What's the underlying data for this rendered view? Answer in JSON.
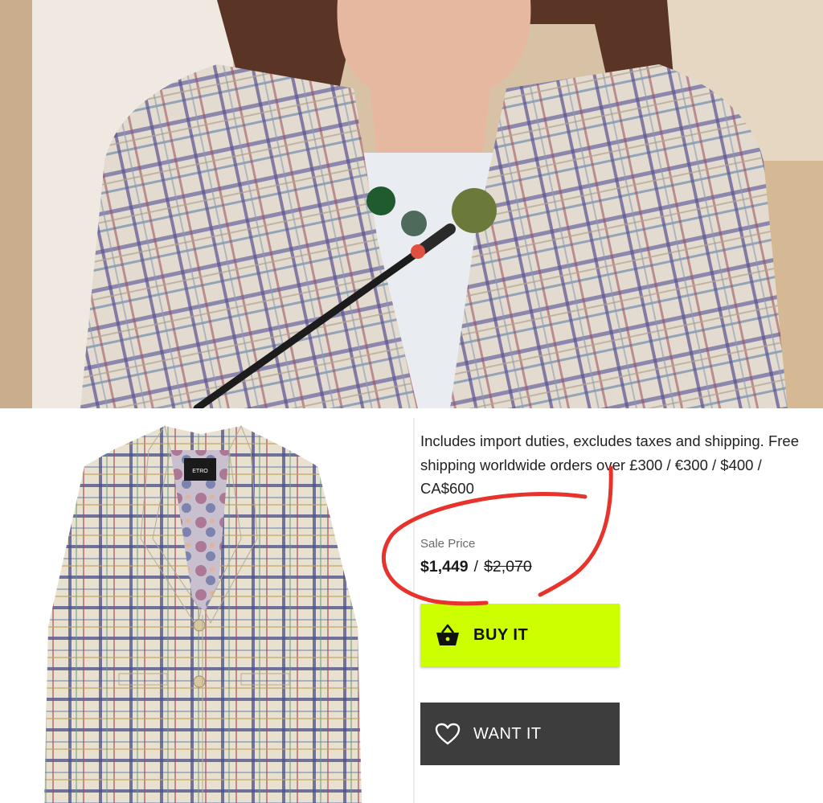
{
  "product": {
    "shipping_note": "Includes import duties, excludes taxes and shipping. Free shipping worldwide orders over £300 / €300 / $400 / CA$600",
    "sale_label": "Sale Price",
    "price_current": "$1,449",
    "price_separator": "/",
    "price_original": "$2,070",
    "brand_tag": "ETRO"
  },
  "actions": {
    "buy_label": "BUY IT",
    "want_label": "WANT IT",
    "buy_icon": "shopping-basket-icon",
    "want_icon": "heart-icon"
  },
  "colors": {
    "buy_button": "#ccff00",
    "want_button": "#3d3d3d",
    "annotation": "#e8322c"
  }
}
